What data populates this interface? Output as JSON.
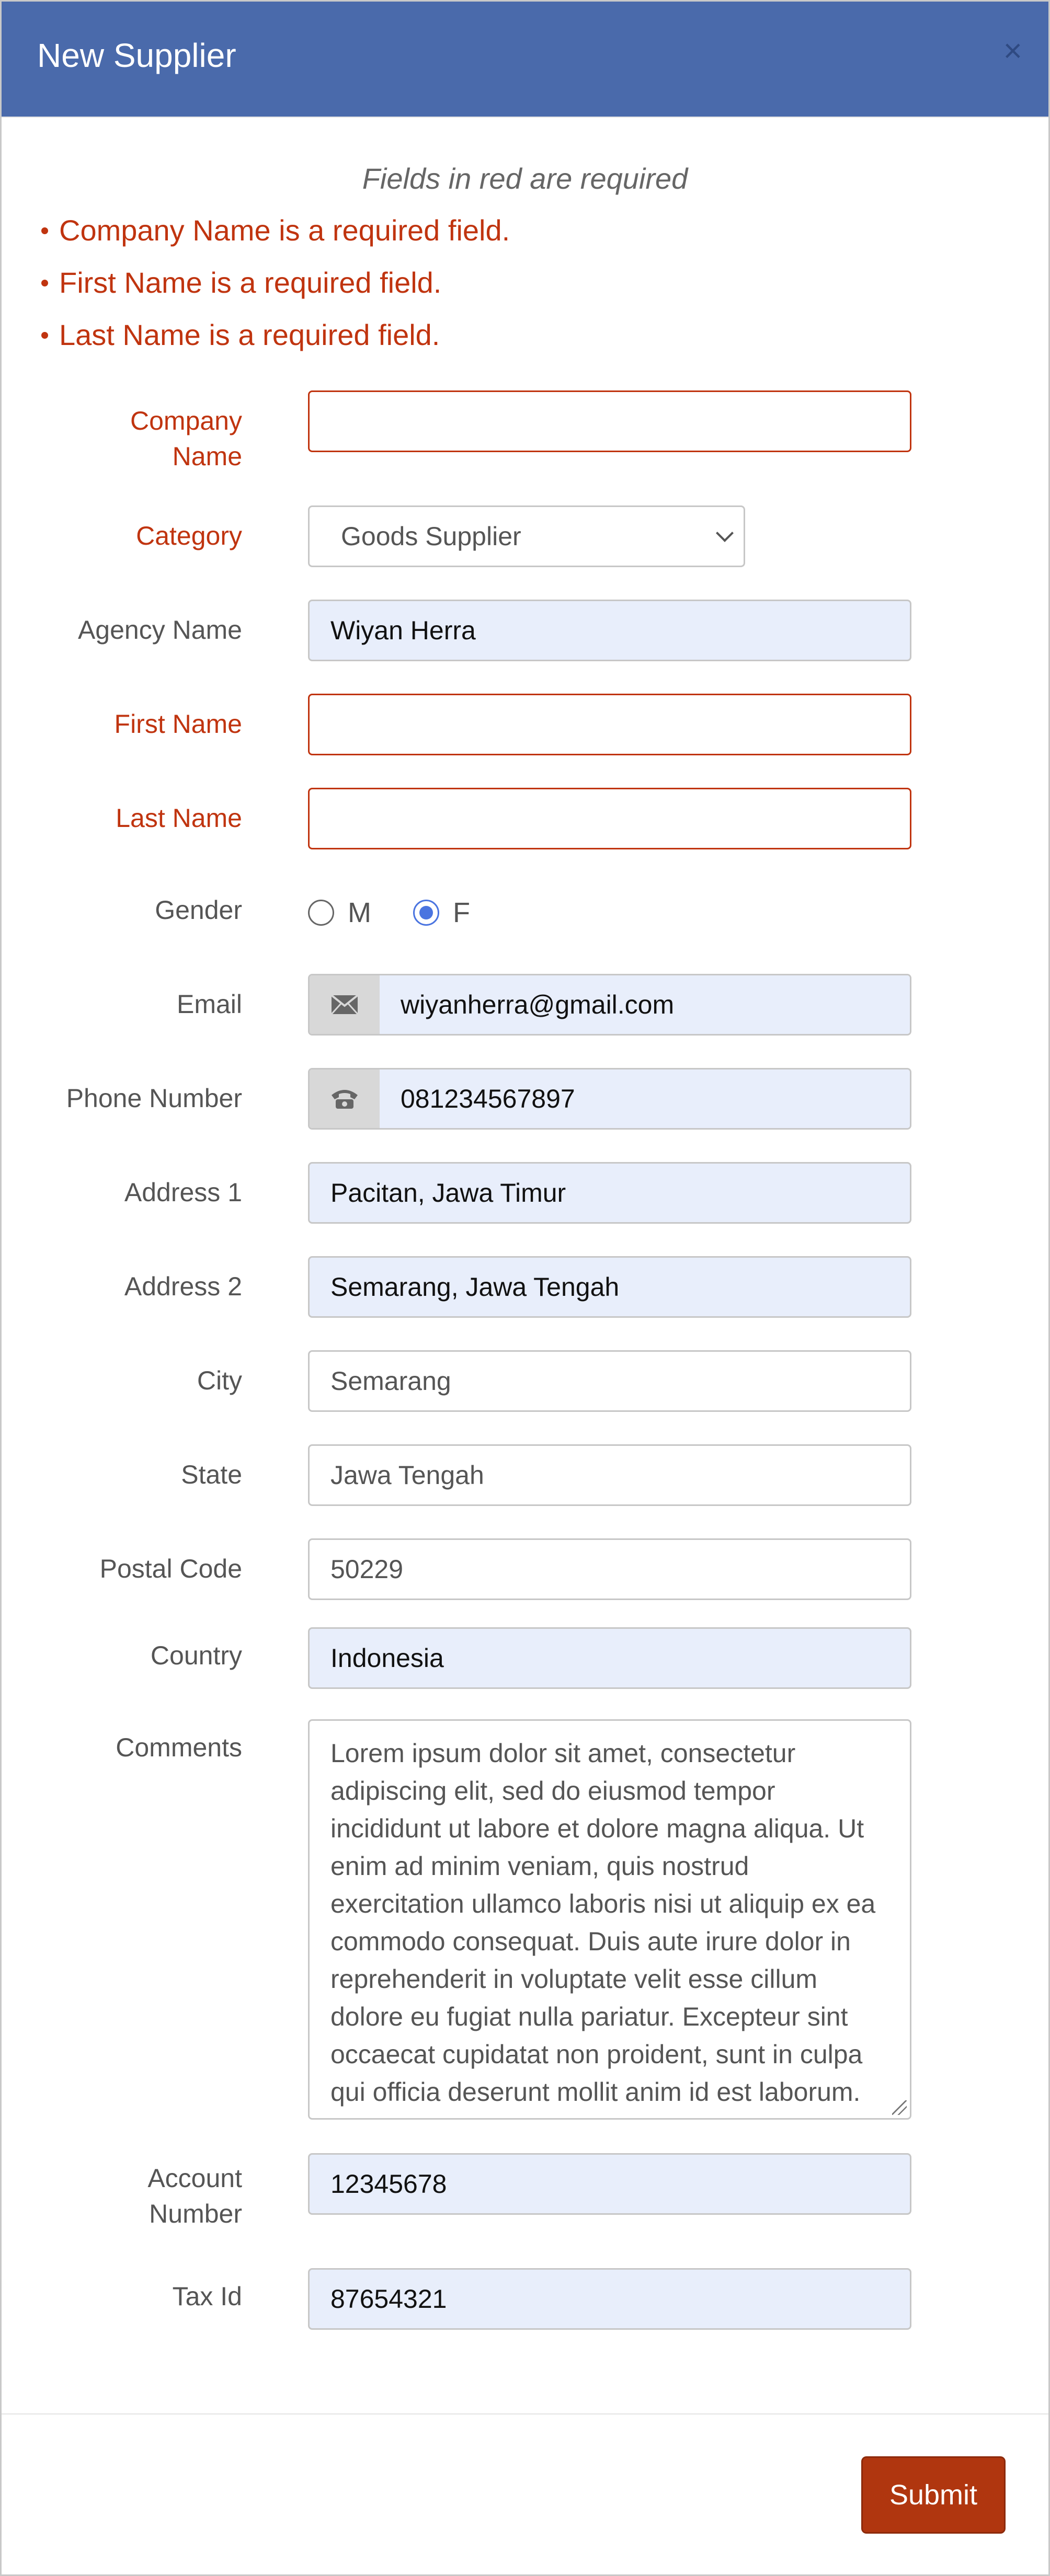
{
  "modal": {
    "title": "New Supplier",
    "close_label": "×",
    "required_note": "Fields in red are required",
    "errors": [
      "Company Name is a required field.",
      "First Name is a required field.",
      "Last Name is a required field."
    ],
    "submit_label": "Submit"
  },
  "form": {
    "company_name": {
      "label_line1": "Company",
      "label_line2": "Name",
      "value": ""
    },
    "category": {
      "label": "Category",
      "value": "Goods Supplier"
    },
    "agency_name": {
      "label": "Agency Name",
      "value": "Wiyan Herra"
    },
    "first_name": {
      "label": "First Name",
      "value": ""
    },
    "last_name": {
      "label": "Last Name",
      "value": ""
    },
    "gender": {
      "label": "Gender",
      "options": [
        "M",
        "F"
      ],
      "selected": "F"
    },
    "email": {
      "label": "Email",
      "value": "wiyanherra@gmail.com",
      "icon": "envelope-icon"
    },
    "phone": {
      "label": "Phone Number",
      "value": "081234567897",
      "icon": "phone-icon"
    },
    "address1": {
      "label": "Address 1",
      "value": "Pacitan, Jawa Timur"
    },
    "address2": {
      "label": "Address 2",
      "value": "Semarang, Jawa Tengah"
    },
    "city": {
      "label": "City",
      "value": "Semarang"
    },
    "state": {
      "label": "State",
      "value": "Jawa Tengah"
    },
    "postal_code": {
      "label": "Postal Code",
      "value": "50229"
    },
    "country": {
      "label": "Country",
      "value": "Indonesia"
    },
    "comments": {
      "label": "Comments",
      "value": "Lorem ipsum dolor sit amet, consectetur adipiscing elit, sed do eiusmod tempor incididunt ut labore et dolore magna aliqua. Ut enim ad minim veniam, quis nostrud exercitation ullamco laboris nisi ut aliquip ex ea commodo consequat. Duis aute irure dolor in reprehenderit in voluptate velit esse cillum dolore eu fugiat nulla pariatur. Excepteur sint occaecat cupidatat non proident, sunt in culpa qui officia deserunt mollit anim id est laborum."
    },
    "account_number": {
      "label_line1": "Account",
      "label_line2": "Number",
      "value": "12345678"
    },
    "tax_id": {
      "label": "Tax Id",
      "value": "87654321"
    }
  },
  "colors": {
    "header": "#4a6aab",
    "required": "#c0340f",
    "filled_bg": "#e8eefb",
    "submit": "#b0360f"
  }
}
